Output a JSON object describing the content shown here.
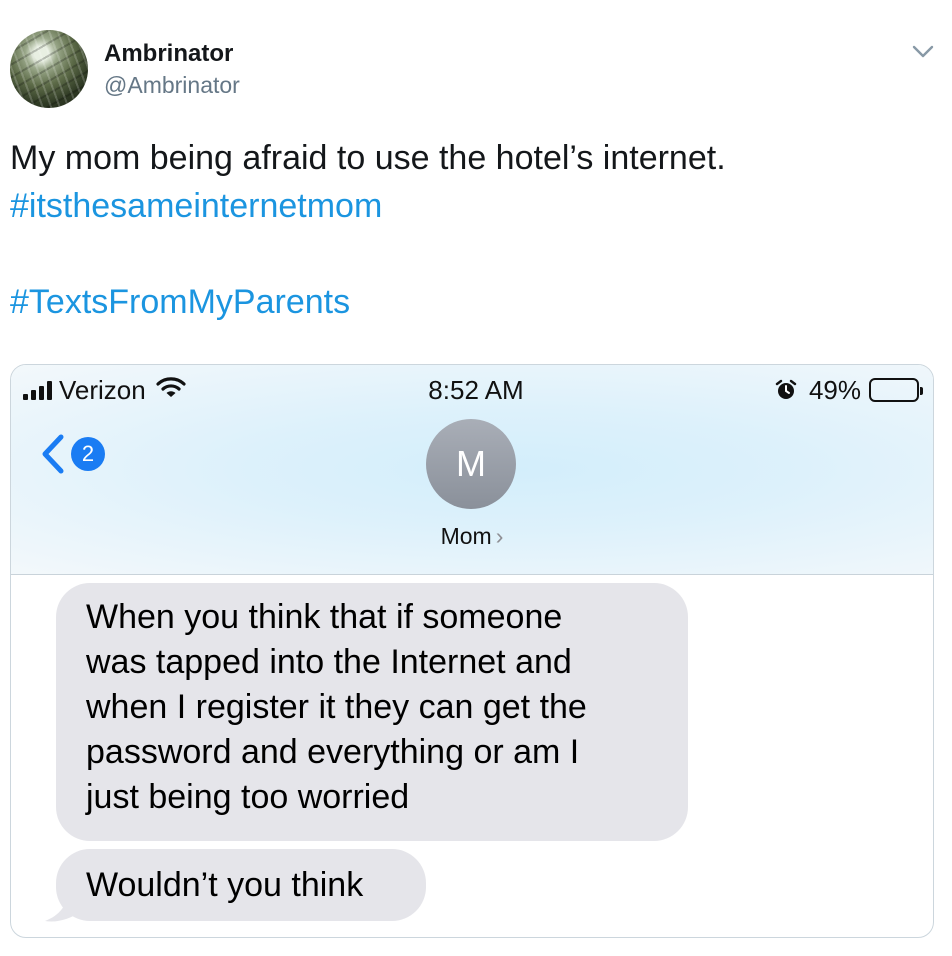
{
  "tweet": {
    "display_name": "Ambrinator",
    "handle": "@Ambrinator",
    "text_line1": "My mom being afraid to use the hotel’s internet.",
    "hashtag1": "#itsthesameinternetmom",
    "hashtag2": "#TextsFromMyParents"
  },
  "status_bar": {
    "carrier": "Verizon",
    "time": "8:52 AM",
    "battery_percent": "49%",
    "battery_level": 0.49
  },
  "messages_header": {
    "back_badge": "2",
    "contact_initial": "M",
    "contact_name": "Mom",
    "chevron": "›"
  },
  "messages": [
    {
      "lines": [
        "When you think that if someone",
        "was tapped into the Internet and",
        "when I register it they can get the",
        "password and everything or am I",
        "just being too worried"
      ]
    },
    {
      "lines": [
        "Wouldn’t you think"
      ]
    }
  ],
  "colors": {
    "hashtag_blue": "#1b95e0",
    "badge_blue": "#1a7cf3",
    "bubble_gray": "#e5e5ea",
    "handle_gray": "#657786"
  },
  "icons": [
    "signal-icon",
    "wifi-icon",
    "alarm-icon",
    "battery-icon",
    "back-chevron-icon",
    "caret-down-icon"
  ]
}
